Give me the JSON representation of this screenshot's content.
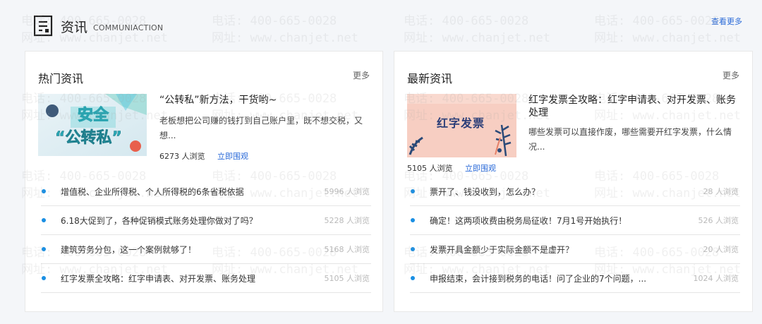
{
  "header": {
    "title": "资讯",
    "subtitle": "COMMUNIACTION",
    "view_more": "查看更多"
  },
  "watermark": {
    "phone": "电话: 400-665-0028",
    "site": "网址: www.chanjet.net"
  },
  "hot": {
    "title": "热门资讯",
    "more": "更多",
    "featured": {
      "title": "“公转私”新方法，干货哟~",
      "desc": "老板想把公司赚的钱打到自己账户里，既不想交税，又想...",
      "views": "6273 人浏览",
      "watch": "立即围观",
      "image_text_1": "安全",
      "image_text_2": "“公转私”"
    },
    "items": [
      {
        "title": "增值税、企业所得税、个人所得税的6条省税依据",
        "views": "5996 人浏览"
      },
      {
        "title": "6.18大促到了，各种促销模式账务处理你做对了吗？",
        "views": "5228 人浏览"
      },
      {
        "title": "建筑劳务分包，这一个案例就够了！",
        "views": "5168 人浏览"
      },
      {
        "title": "红字发票全攻略：红字申请表、对开发票、账务处理",
        "views": "5105 人浏览"
      }
    ]
  },
  "latest": {
    "title": "最新资讯",
    "more": "更多",
    "featured": {
      "title": "红字发票全攻略：红字申请表、对开发票、账务处理",
      "desc": "哪些发票可以直接作废，哪些需要开红字发票，什么情况...",
      "views": "5105 人浏览",
      "watch": "立即围观",
      "image_text": "红字发票"
    },
    "items": [
      {
        "title": "票开了、钱没收到，怎么办？",
        "views": "28 人浏览"
      },
      {
        "title": "确定！这两项收费由税务局征收！7月1号开始执行！",
        "views": "526 人浏览"
      },
      {
        "title": "发票开具金额少于实际金额不是虚开？",
        "views": "20 人浏览"
      },
      {
        "title": "申报结束，会计接到税务的电话！问了企业的7个问题，...",
        "views": "1024 人浏览"
      }
    ]
  },
  "colors": {
    "accent": "#2a6ad8",
    "bullet": "#1a8fe3"
  }
}
